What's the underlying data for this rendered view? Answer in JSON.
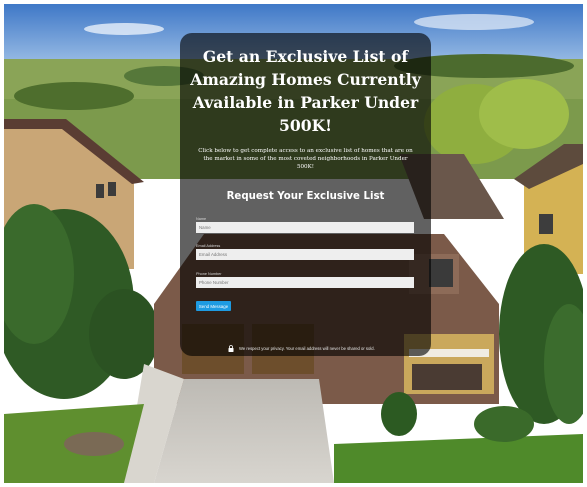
{
  "headline": "Get an Exclusive List of Amazing Homes Currently Available in Parker Under 500K!",
  "subheadline": "Click below to get complete access to an exclusive list of homes that are on the market in some of the most coveted neighborhoods in Parker Under 500K!",
  "form": {
    "title": "Request Your Exclusive List",
    "fields": [
      {
        "label": "Name",
        "placeholder": "Name"
      },
      {
        "label": "Email Address",
        "placeholder": "Email Address"
      },
      {
        "label": "Phone Number",
        "placeholder": "Phone Number"
      }
    ],
    "submit_label": "Send Message"
  },
  "privacy": {
    "icon": "lock-icon",
    "text": "We respect your privacy. Your email address will never be shared or sold."
  },
  "colors": {
    "button": "#1e9be2",
    "overlay": "rgba(0,0,0,0.62)",
    "text": "#ffffff"
  }
}
